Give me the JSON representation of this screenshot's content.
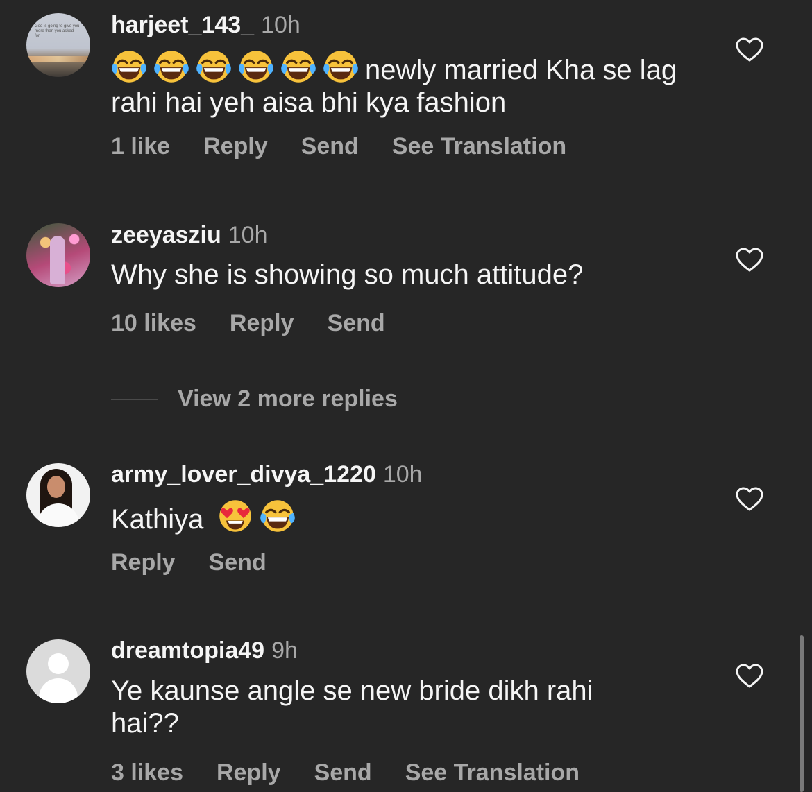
{
  "comments": [
    {
      "username": "harjeet_143_",
      "time": "10h",
      "text": "newly married Kha se lag rahi hai yeh aisa bhi kya fashion",
      "emoji": [
        "face-with-tears-of-joy",
        "face-with-tears-of-joy",
        "face-with-tears-of-joy",
        "face-with-tears-of-joy",
        "face-with-tears-of-joy",
        "face-with-tears-of-joy"
      ],
      "likes": "1 like",
      "reply": "Reply",
      "send": "Send",
      "translate": "See Translation",
      "avatar_text": "God is going to give you more than you asked for."
    },
    {
      "username": "zeeyasziu",
      "time": "10h",
      "text": "Why she is showing so much attitude?",
      "likes": "10 likes",
      "reply": "Reply",
      "send": "Send"
    },
    {
      "username": "army_lover_divya_1220",
      "time": "10h",
      "text": "Kathiya",
      "emoji": [
        "smiling-face-with-heart-eyes",
        "face-with-tears-of-joy"
      ],
      "reply": "Reply",
      "send": "Send"
    },
    {
      "username": "dreamtopia49",
      "time": "9h",
      "text": "Ye kaunse angle se new bride dikh rahi hai??",
      "likes": "3 likes",
      "reply": "Reply",
      "send": "Send",
      "translate": "See Translation"
    }
  ],
  "view_more": "View 2 more replies",
  "colors": {
    "background": "#262626",
    "text": "#f5f5f5",
    "secondary": "#a8a8a8"
  }
}
